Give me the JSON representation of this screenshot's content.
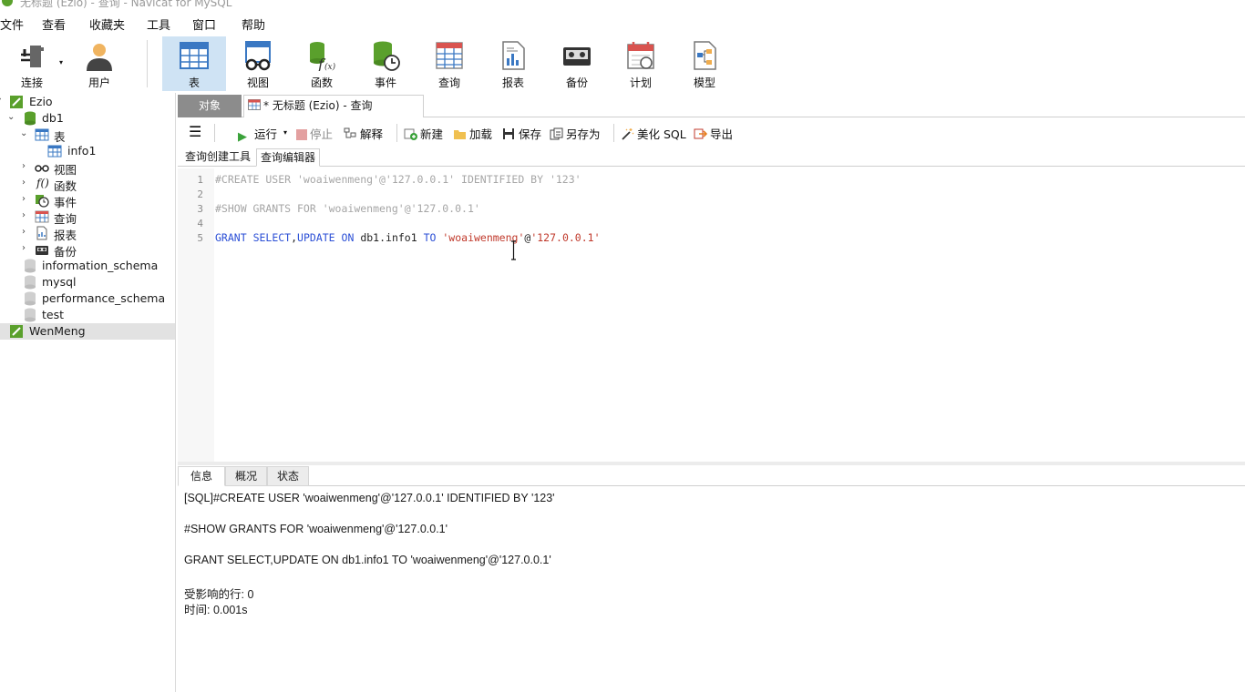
{
  "window": {
    "title": "无标题 (Ezio) - 查询 - Navicat for MySQL"
  },
  "menu": {
    "items": [
      "文件",
      "查看",
      "收藏夹",
      "工具",
      "窗口",
      "帮助"
    ]
  },
  "toolbar": {
    "connect": "连接",
    "user": "用户",
    "table": "表",
    "view": "视图",
    "function": "函数",
    "event": "事件",
    "query": "查询",
    "report": "报表",
    "backup": "备份",
    "schedule": "计划",
    "model": "模型"
  },
  "tree": {
    "conn1": "Ezio",
    "db1": "db1",
    "tables": "表",
    "table1": "info1",
    "views": "视图",
    "functions": "函数",
    "events": "事件",
    "queries": "查询",
    "reports": "报表",
    "backups": "备份",
    "db_info": "information_schema",
    "db_mysql": "mysql",
    "db_perf": "performance_schema",
    "db_test": "test",
    "conn2": "WenMeng"
  },
  "tabs": {
    "objects": "对象",
    "query": "* 无标题 (Ezio) - 查询"
  },
  "editor_toolbar": {
    "run": "运行",
    "stop": "停止",
    "explain": "解释",
    "new": "新建",
    "load": "加载",
    "save": "保存",
    "save_as": "另存为",
    "beautify": "美化 SQL",
    "export": "导出"
  },
  "subtabs": {
    "builder": "查询创建工具",
    "editor": "查询编辑器"
  },
  "editor": {
    "line_numbers": [
      "1",
      "2",
      "3",
      "4",
      "5"
    ],
    "line1": "#CREATE USER 'woaiwenmeng'@'127.0.0.1' IDENTIFIED BY '123'",
    "line3": "#SHOW GRANTS FOR 'woaiwenmeng'@'127.0.0.1'",
    "line5": {
      "grant": "GRANT",
      "select": "SELECT",
      "comma": ",",
      "update": "UPDATE",
      "on": "ON",
      "object": "db1.info1",
      "to": "TO",
      "user": "'woaiwenmeng'",
      "at": "@",
      "host": "'127.0.0.1'"
    }
  },
  "result_tabs": {
    "info": "信息",
    "overview": "概况",
    "status": "状态"
  },
  "messages": {
    "m1": "[SQL]#CREATE USER 'woaiwenmeng'@'127.0.0.1' IDENTIFIED BY '123'",
    "m2": "#SHOW GRANTS FOR 'woaiwenmeng'@'127.0.0.1'",
    "m3": "GRANT SELECT,UPDATE ON db1.info1 TO 'woaiwenmeng'@'127.0.0.1'",
    "m4": "受影响的行: 0",
    "m5": "时间: 0.001s"
  },
  "colors": {
    "keyword": "#2b4fd6",
    "string": "#c0392b",
    "comment": "#a6a6a6",
    "active_tool": "#cfe3f4",
    "navicat_green": "#5aa02c"
  }
}
